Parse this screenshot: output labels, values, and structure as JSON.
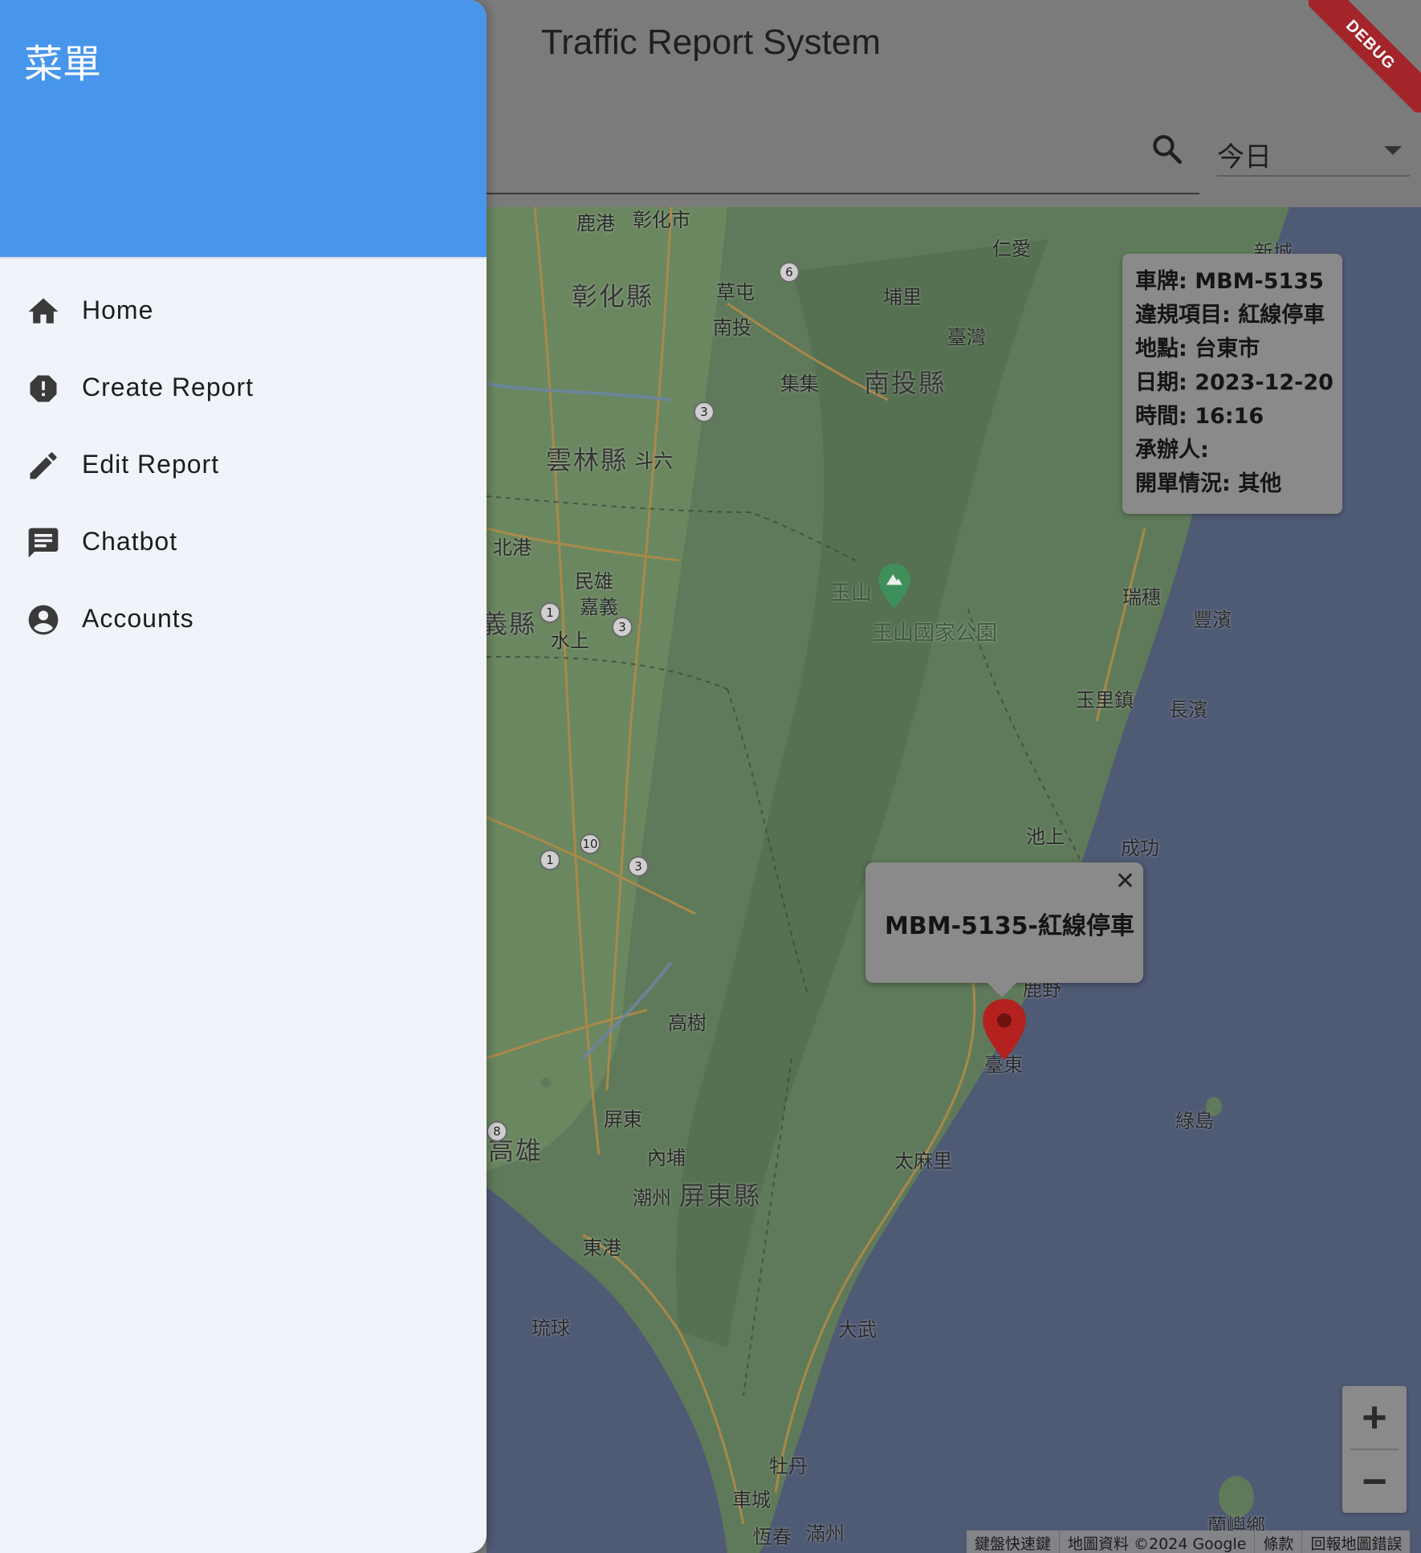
{
  "drawer": {
    "title": "菜單",
    "items": [
      {
        "label": "Home",
        "icon": "home-icon"
      },
      {
        "label": "Create Report",
        "icon": "report-icon"
      },
      {
        "label": "Edit Report",
        "icon": "edit-icon"
      },
      {
        "label": "Chatbot",
        "icon": "chat-icon"
      },
      {
        "label": "Accounts",
        "icon": "account-circle-icon"
      }
    ],
    "header_color": "#4896ec"
  },
  "appbar": {
    "title": "Traffic Report System",
    "date_filter": "今日",
    "debug_banner": "DEBUG"
  },
  "info_card": {
    "plate": "車牌: MBM-5135",
    "violation": "違規項目: 紅線停車",
    "location": "地點: 台東市",
    "date": "日期: 2023-12-20",
    "time": "時間: 16:16",
    "officer": "承辦人:",
    "ticket_status": "開單情況: 其他"
  },
  "marker_bubble": {
    "text": "MBM-5135-紅線停車",
    "close": "✕"
  },
  "map": {
    "labels": {
      "lugang": "鹿港",
      "changhua_city": "彰化市",
      "renai": "仁愛",
      "xincheng": "新城",
      "changhua_county": "彰化縣",
      "caotun": "草屯",
      "puli": "埔里",
      "nantou": "南投",
      "taiwan": "臺灣",
      "jiji": "集集",
      "nantou_county": "南投縣",
      "yunlin_county": "雲林縣",
      "douliu": "斗六",
      "beigang": "北港",
      "minxiong": "民雄",
      "chiayi": "嘉義",
      "yi_county": "義縣",
      "shuishang": "水上",
      "yushan": "玉山",
      "yushan_park": "玉山國家公園",
      "ruisui": "瑞穗",
      "fengbin": "豐濱",
      "yuli": "玉里鎮",
      "changbin": "長濱",
      "chishang": "池上",
      "chenggong": "成功",
      "luye": "鹿野",
      "gaoshu": "高樹",
      "taitung": "臺東",
      "lvdao": "綠島",
      "pingtung": "屏東",
      "kaohsiung": "高雄",
      "neipu": "內埔",
      "taimali": "太麻里",
      "chaozhou": "潮州",
      "pingtung_county": "屏東縣",
      "donggang": "東港",
      "liuqiu": "琉球",
      "dawu": "大武",
      "mudan": "牡丹",
      "checheng": "車城",
      "hengchun": "恆春",
      "manzhou": "滿州",
      "lanyu": "蘭嶼鄉"
    },
    "route_numbers": [
      "6",
      "3",
      "1",
      "3",
      "10",
      "1",
      "3",
      "8"
    ],
    "zoom_in": "+",
    "zoom_out": "−",
    "attribution": [
      "鍵盤快速鍵",
      "地圖資料 ©2024 Google",
      "條款",
      "回報地圖錯誤"
    ],
    "colors": {
      "land": "#5f7a5a",
      "sea": "#4f5a74",
      "roads": "#b08a48",
      "marker": "#b3221f"
    }
  }
}
